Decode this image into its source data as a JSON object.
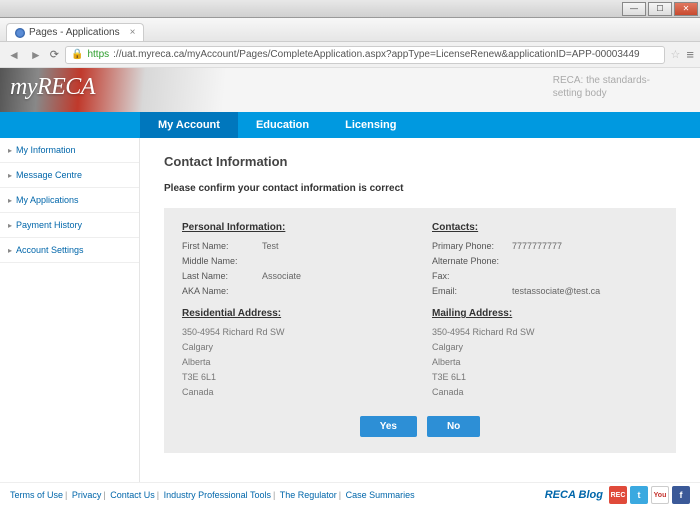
{
  "window": {
    "min": "—",
    "max": "☐",
    "close": "✕"
  },
  "browser": {
    "tab_title": "Pages - Applications",
    "tab_close": "×",
    "back": "◄",
    "forward": "►",
    "reload": "⟳",
    "menu": "≡",
    "star": "☆",
    "lock": "🔒",
    "scheme": "https",
    "url_rest": "://uat.myreca.ca/myAccount/Pages/CompleteApplication.aspx?appType=LicenseRenew&applicationID=APP-00003449"
  },
  "header": {
    "logo": "myRECA",
    "tagline_l1": "RECA: the standards-",
    "tagline_l2": "setting body"
  },
  "nav": {
    "my_account": "My Account",
    "education": "Education",
    "licensing": "Licensing"
  },
  "sidebar": {
    "items": [
      {
        "label": "My Information"
      },
      {
        "label": "Message Centre"
      },
      {
        "label": "My Applications"
      },
      {
        "label": "Payment History"
      },
      {
        "label": "Account Settings"
      }
    ],
    "caret": "▸"
  },
  "main": {
    "title": "Contact Information",
    "instruction": "Please confirm your contact information is correct",
    "personal": {
      "heading": "Personal Information:",
      "first_name_lbl": "First Name:",
      "first_name_val": "Test",
      "middle_lbl": "Middle Name:",
      "middle_val": "",
      "last_lbl": "Last Name:",
      "last_val": "Associate",
      "aka_lbl": "AKA Name:",
      "aka_val": ""
    },
    "contacts": {
      "heading": "Contacts:",
      "primary_lbl": "Primary Phone:",
      "primary_val": "7777777777",
      "alt_lbl": "Alternate Phone:",
      "alt_val": "",
      "fax_lbl": "Fax:",
      "fax_val": "",
      "email_lbl": "Email:",
      "email_val": "testassociate@test.ca"
    },
    "residential": {
      "heading": "Residential Address:",
      "l1": "350-4954 Richard Rd SW",
      "l2": "Calgary",
      "l3": "Alberta",
      "l4": "T3E 6L1",
      "l5": "Canada"
    },
    "mailing": {
      "heading": "Mailing Address:",
      "l1": "350-4954 Richard Rd SW",
      "l2": "Calgary",
      "l3": "Alberta",
      "l4": "T3E 6L1",
      "l5": "Canada"
    },
    "yes": "Yes",
    "no": "No"
  },
  "footer": {
    "links": [
      "Terms of Use",
      "Privacy",
      "Contact Us",
      "Industry Professional Tools",
      "The Regulator",
      "Case Summaries"
    ],
    "sep": "|",
    "blog": "RECA Blog",
    "rec": "REC",
    "tw": "t",
    "yt": "You",
    "fb": "f"
  }
}
